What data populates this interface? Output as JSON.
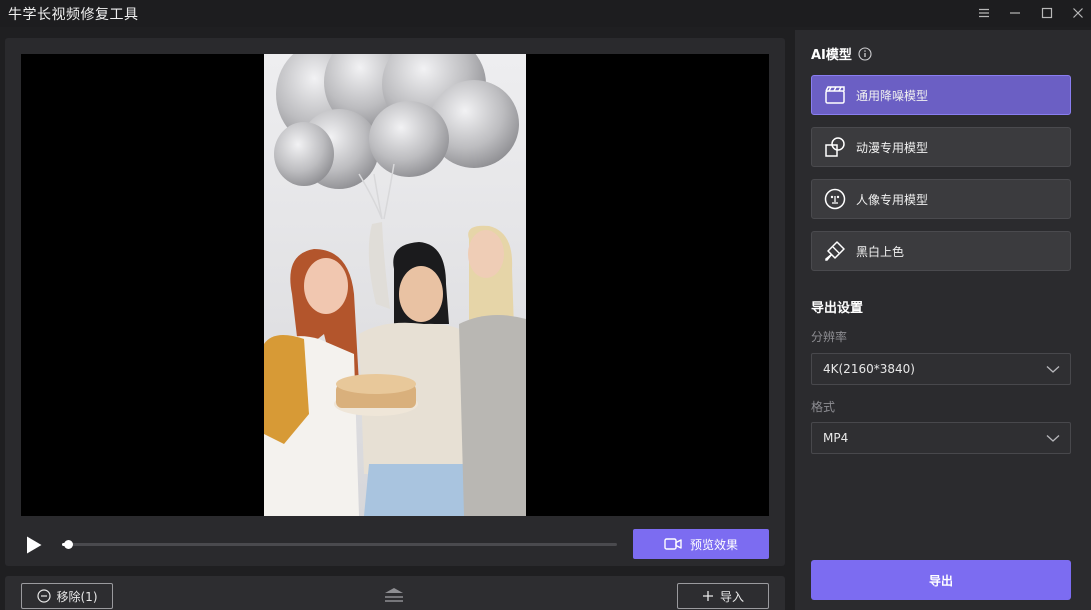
{
  "window": {
    "title": "牛学长视频修复工具"
  },
  "player": {
    "progress_fraction": 0.01,
    "preview_label": "预览效果"
  },
  "bottom_bar": {
    "remove_label": "移除(1)",
    "import_label": "导入"
  },
  "ai_model": {
    "title": "AI模型",
    "models": [
      {
        "label": "通用降噪模型",
        "icon": "clapperboard-icon",
        "active": true
      },
      {
        "label": "动漫专用模型",
        "icon": "shapes-icon",
        "active": false
      },
      {
        "label": "人像专用模型",
        "icon": "face-icon",
        "active": false
      },
      {
        "label": "黑白上色",
        "icon": "paint-brush-icon",
        "active": false
      }
    ]
  },
  "export_settings": {
    "title": "导出设置",
    "resolution_label": "分辨率",
    "resolution_value": "4K(2160*3840)",
    "format_label": "格式",
    "format_value": "MP4",
    "export_label": "导出"
  },
  "colors": {
    "accent": "#7c6cf1",
    "active_model": "#6b5fc4",
    "sidebar_bg": "#2b2b2e",
    "app_bg": "#1f1f21"
  }
}
